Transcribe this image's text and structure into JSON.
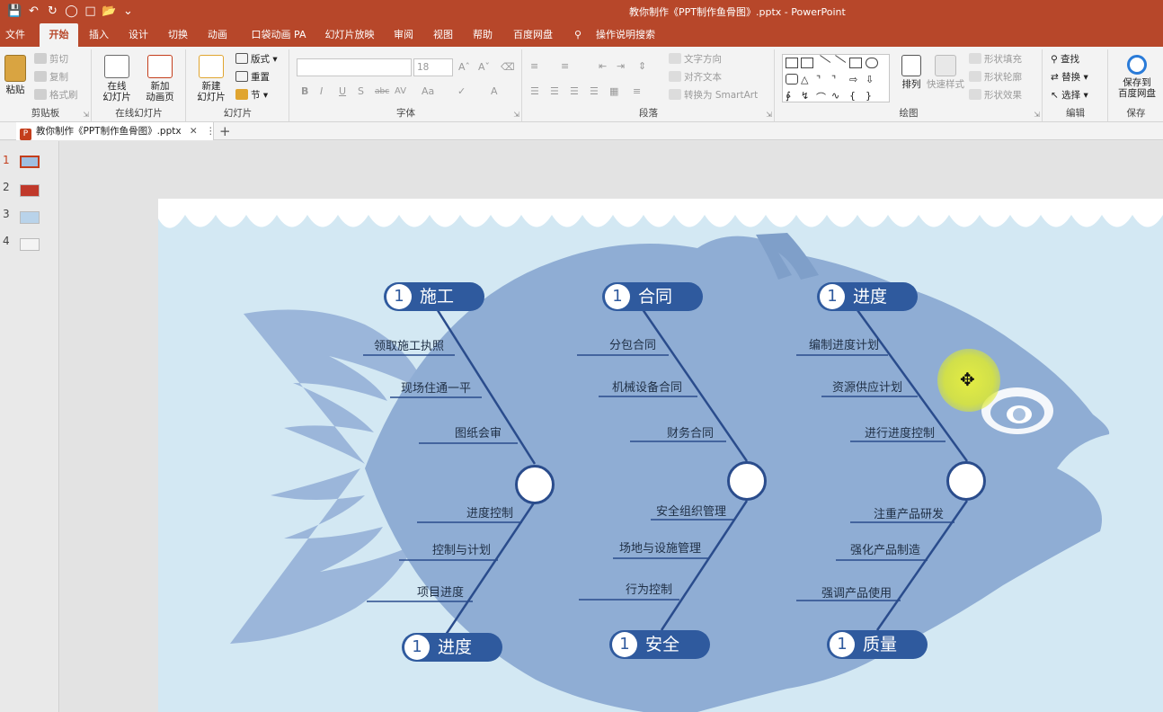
{
  "app": {
    "window_title": "教你制作《PPT制作鱼骨图》.pptx  -  PowerPoint"
  },
  "quick_access": {
    "icons": [
      "save-icon",
      "undo-icon",
      "redo-icon",
      "present-icon",
      "new-icon",
      "open-icon",
      "customize-icon"
    ]
  },
  "tabs": [
    "文件",
    "开始",
    "插入",
    "设计",
    "切换",
    "动画",
    "口袋动画 PA",
    "幻灯片放映",
    "审阅",
    "视图",
    "帮助",
    "百度网盘",
    "操作说明搜索"
  ],
  "active_tab": "开始",
  "ribbon": {
    "clipboard": {
      "label": "剪贴板",
      "paste": "粘贴",
      "cut": "剪切",
      "copy": "复制",
      "format_painter": "格式刷"
    },
    "online": {
      "label": "在线幻灯片",
      "online_slides": "在线\n幻灯片",
      "new_anim_page": "新加\n动画页"
    },
    "slides": {
      "label": "幻灯片",
      "new_slide": "新建\n幻灯片",
      "layout": "版式",
      "reset": "重置",
      "section": "节"
    },
    "font": {
      "label": "字体",
      "font_name": "",
      "font_size": "18",
      "bold": "B",
      "italic": "I",
      "underline": "U",
      "shadow": "S",
      "strike": "abc",
      "spacing": "AV",
      "case": "Aa",
      "font_color": "A"
    },
    "paragraph": {
      "label": "段落",
      "text_direction": "文字方向",
      "align_text": "对齐文本",
      "convert_smartart": "转换为 SmartArt"
    },
    "drawing": {
      "label": "绘图",
      "arrange": "排列",
      "quick_styles": "快速样式",
      "shape_fill": "形状填充",
      "shape_outline": "形状轮廓",
      "shape_effects": "形状效果"
    },
    "editing": {
      "label": "编辑",
      "find": "查找",
      "replace": "替换",
      "select": "选择"
    },
    "save": {
      "label": "保存",
      "save_to_baidu": "保存到\n百度网盘"
    }
  },
  "document_tab": {
    "name": "教你制作《PPT制作鱼骨图》.pptx"
  },
  "thumbnails": [
    "1",
    "2",
    "3",
    "4"
  ],
  "active_slide": 1,
  "fishbone": {
    "top_heads": [
      {
        "num": "1",
        "label": "施工"
      },
      {
        "num": "1",
        "label": "合同"
      },
      {
        "num": "1",
        "label": "进度"
      }
    ],
    "bottom_heads": [
      {
        "num": "1",
        "label": "进度"
      },
      {
        "num": "1",
        "label": "安全"
      },
      {
        "num": "1",
        "label": "质量"
      }
    ],
    "top_bones": [
      [
        "领取施工执照",
        "现场住通一平",
        "图纸会审"
      ],
      [
        "分包合同",
        "机械设备合同",
        "财务合同"
      ],
      [
        "编制进度计划",
        "资源供应计划",
        "进行进度控制"
      ]
    ],
    "bottom_bones": [
      [
        "进度控制",
        "控制与计划",
        "项目进度"
      ],
      [
        "安全组织管理",
        "场地与设施管理",
        "行为控制"
      ],
      [
        "注重产品研发",
        "强化产品制造",
        "强调产品使用"
      ]
    ]
  },
  "colors": {
    "brand": "#b7472a",
    "fish_body": "#8fadd4",
    "pill": "#2f5a9e",
    "bone_line": "#2a4c8c",
    "slide_bg": "#d3e8f3"
  }
}
